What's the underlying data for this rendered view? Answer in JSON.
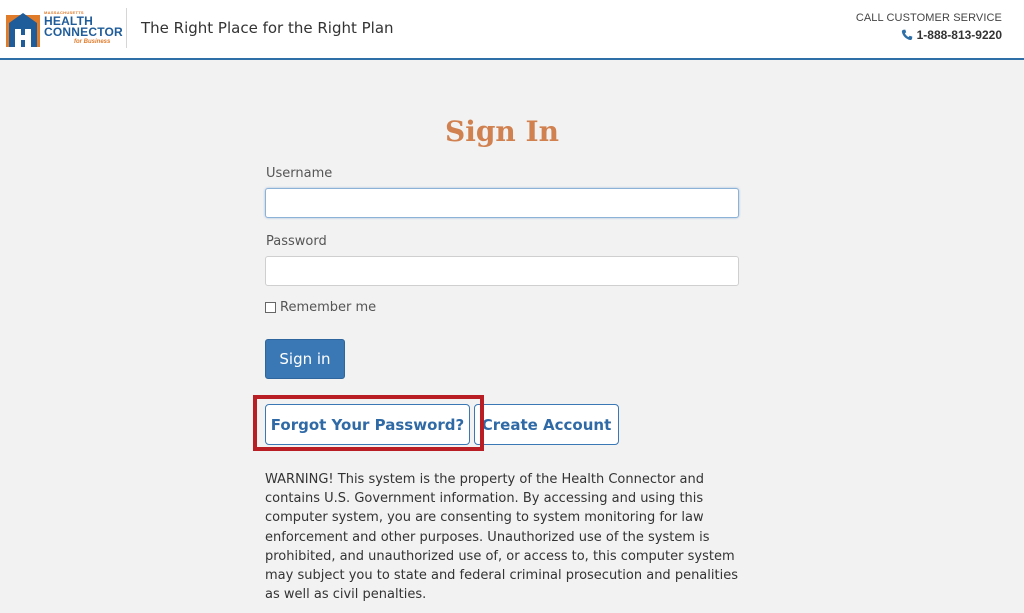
{
  "header": {
    "logo": {
      "small_text": "MASSACHUSETTS",
      "line1": "HEALTH",
      "line2": "CONNECTOR",
      "line3": "for Business"
    },
    "tagline": "The Right Place for the Right Plan",
    "customer_service_label": "CALL CUSTOMER SERVICE",
    "phone": "1-888-813-9220"
  },
  "form": {
    "title": "Sign In",
    "username_label": "Username",
    "username_value": "",
    "password_label": "Password",
    "password_value": "",
    "remember_label": "Remember me",
    "remember_checked": false,
    "signin_label": "Sign in",
    "forgot_label": "Forgot Your Password?",
    "create_label": "Create Account"
  },
  "warning_text": "WARNING! This system is the property of the Health Connector and contains U.S. Government information. By accessing and using this computer system, you are consenting to system monitoring for law enforcement and other purposes. Unauthorized use of the system is prohibited, and unauthorized use of, or access to, this computer system may subject you to state and federal criminal prosecution and penalities as well as civil penalties.",
  "colors": {
    "brand_blue": "#1f5c9a",
    "brand_orange": "#e07b2a",
    "button_blue": "#3a78b5",
    "highlight_red": "#b81e23",
    "title_orange": "#d0814f"
  },
  "icons": {
    "logo_mark": "health-connector-logo-icon",
    "phone": "phone-icon"
  }
}
